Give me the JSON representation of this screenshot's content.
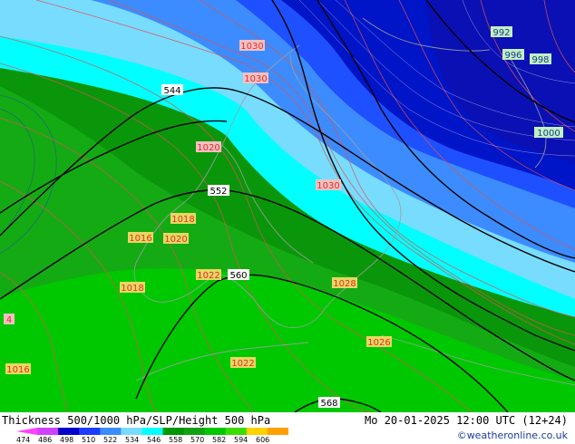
{
  "footer": {
    "title": "Thickness 500/1000 hPa/SLP/Height 500 hPa",
    "valid": "Mo 20-01-2025 12:00 UTC (12+24)",
    "credit": "©weatheronline.co.uk"
  },
  "colorbar": {
    "ticks": [
      "474",
      "486",
      "498",
      "510",
      "522",
      "534",
      "546",
      "558",
      "570",
      "582",
      "594",
      "606"
    ],
    "colors": [
      "#ff40ff",
      "#d040ff",
      "#0000c8",
      "#1e3cff",
      "#3a8cff",
      "#78dcff",
      "#00ffff",
      "#009600",
      "#14a014",
      "#00c800",
      "#3cdc00",
      "#ffd200",
      "#ffa000"
    ]
  },
  "map": {
    "colors": {
      "deep_blue": "#0014c8",
      "blue": "#1e50ff",
      "mid_blue": "#3c8cff",
      "light_blue": "#78dcff",
      "cyan": "#00ffff",
      "dark_green": "#009600",
      "green": "#14aa14",
      "bright_green": "#00c800",
      "isobar": "#e05050",
      "height_contour": "#000000"
    },
    "pressure_labels": [
      {
        "text": "1030"
      },
      {
        "text": "1030"
      },
      {
        "text": "1020"
      },
      {
        "text": "1030"
      },
      {
        "text": "1018"
      },
      {
        "text": "1016"
      },
      {
        "text": "1020"
      },
      {
        "text": "1022"
      },
      {
        "text": "1028"
      },
      {
        "text": "1018"
      },
      {
        "text": "1026"
      },
      {
        "text": "1022"
      },
      {
        "text": "1016"
      },
      {
        "text": "4"
      }
    ],
    "blue_labels": [
      {
        "text": "992"
      },
      {
        "text": "996"
      },
      {
        "text": "998"
      },
      {
        "text": "1000"
      }
    ],
    "height_labels": [
      {
        "text": "544"
      },
      {
        "text": "552"
      },
      {
        "text": "560"
      },
      {
        "text": "568"
      }
    ]
  }
}
